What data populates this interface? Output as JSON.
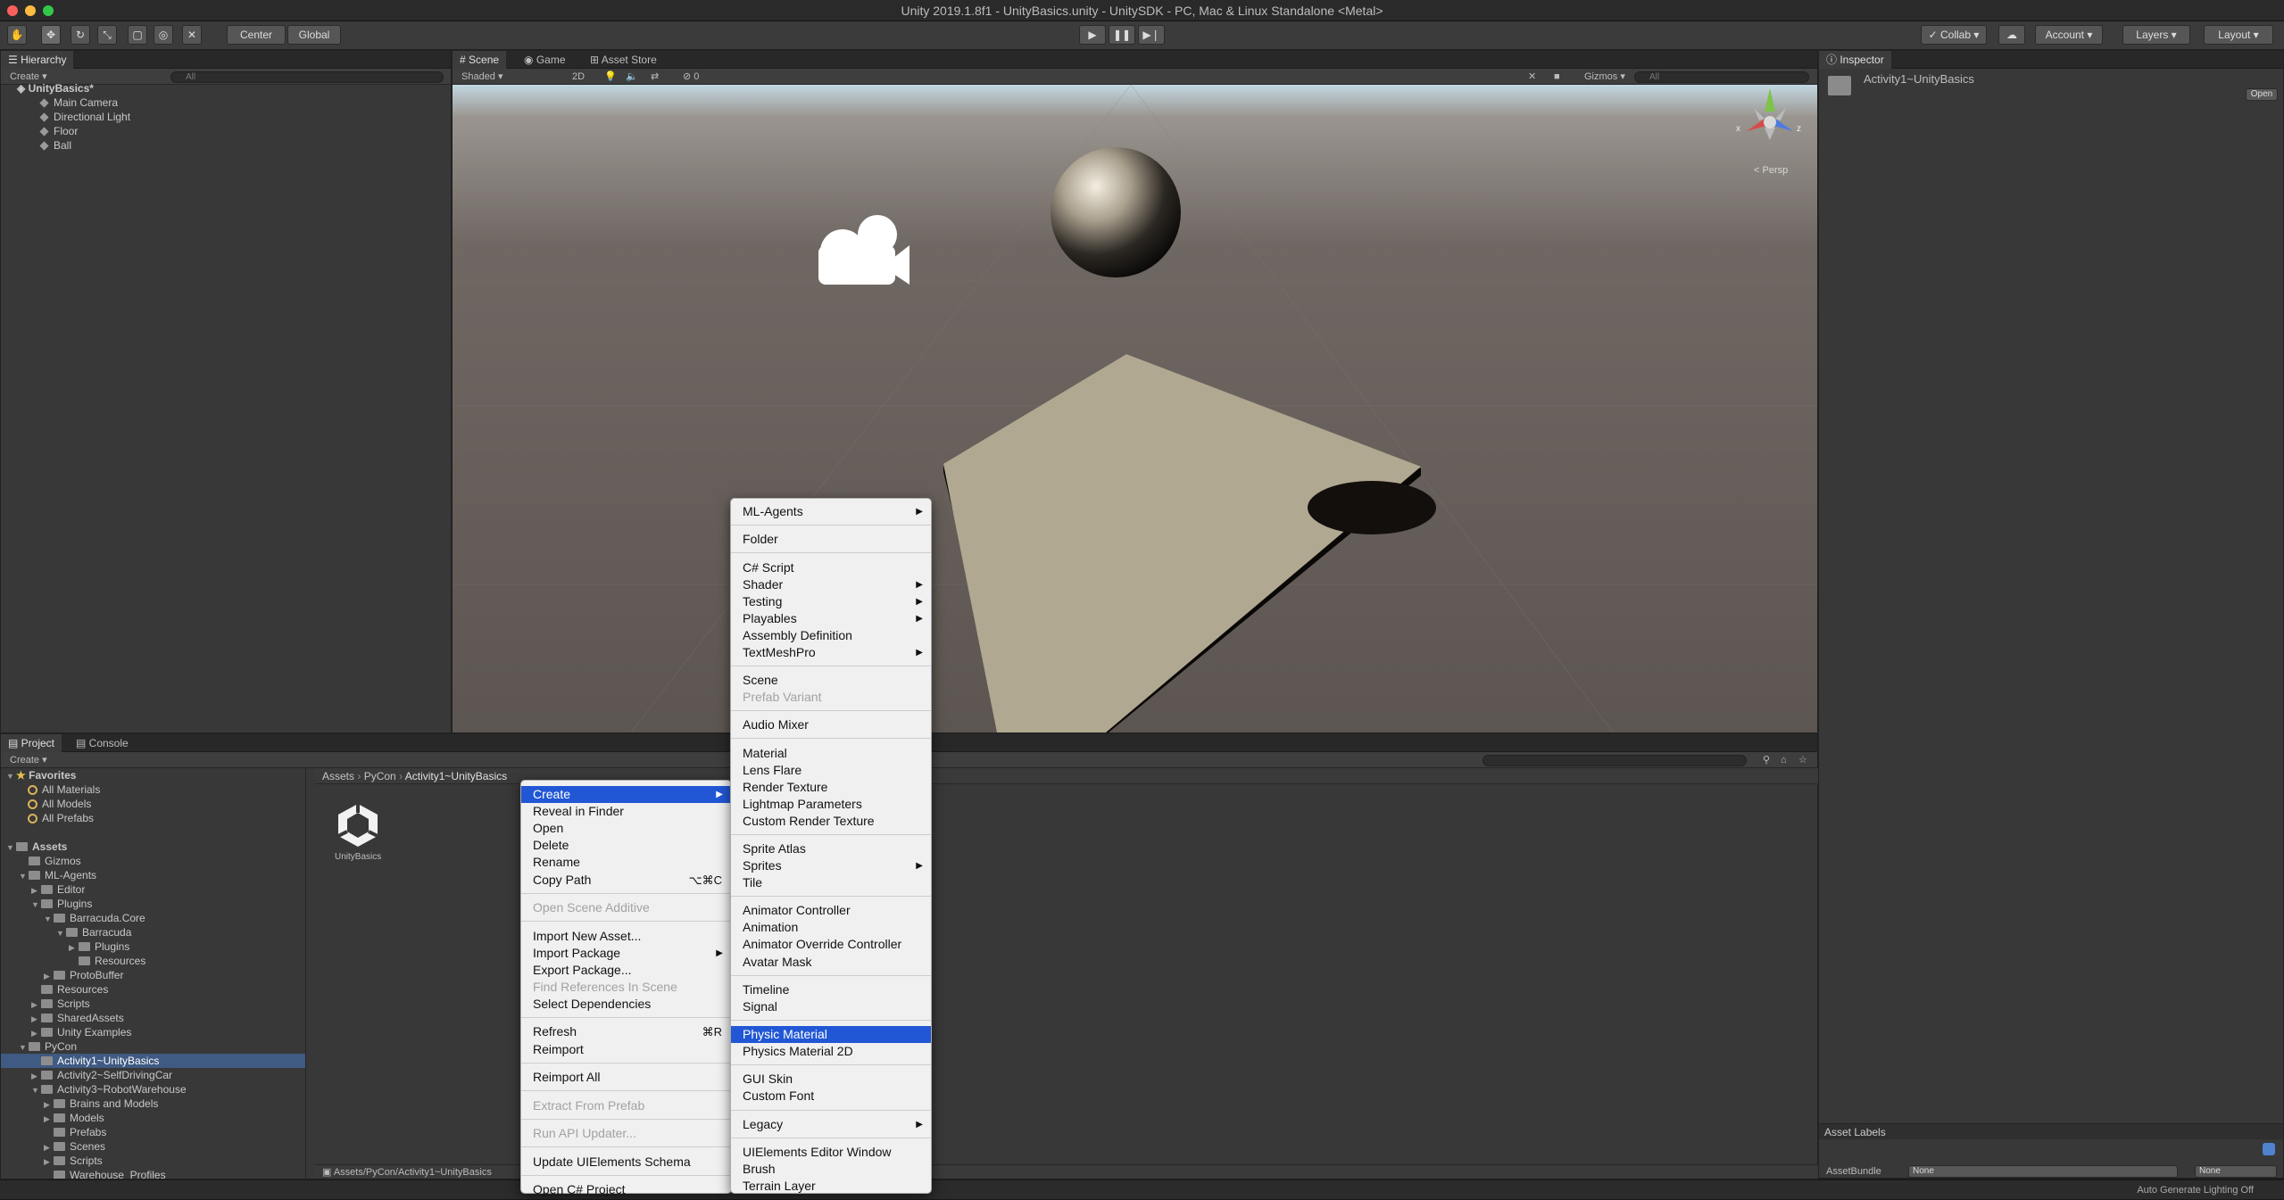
{
  "window": {
    "title": "Unity 2019.1.8f1 - UnityBasics.unity - UnitySDK - PC, Mac & Linux Standalone <Metal>"
  },
  "toolbar": {
    "pivot": "Center",
    "space": "Global",
    "collab": "Collab",
    "account": "Account",
    "layers": "Layers",
    "layout": "Layout"
  },
  "hierarchy": {
    "tab": "Hierarchy",
    "create": "Create",
    "search_placeholder": "All",
    "scene": "UnityBasics*",
    "items": [
      "Main Camera",
      "Directional Light",
      "Floor",
      "Ball"
    ]
  },
  "scene_view": {
    "tabs": [
      "Scene",
      "Game",
      "Asset Store"
    ],
    "shading": "Shaded",
    "mode_2d": "2D",
    "hidden_count": "0",
    "gizmos": "Gizmos",
    "search_placeholder": "All",
    "persp": "< Persp",
    "axis_x": "x",
    "axis_z": "z"
  },
  "inspector": {
    "tab": "Inspector",
    "asset_name": "Activity1~UnityBasics",
    "open_button": "Open",
    "asset_labels": "Asset Labels",
    "asset_bundle_label": "AssetBundle",
    "asset_bundle_value": "None",
    "asset_bundle_variant": "None"
  },
  "project": {
    "tabs": [
      "Project",
      "Console"
    ],
    "create": "Create",
    "favorites_label": "Favorites",
    "favorites": [
      "All Materials",
      "All Models",
      "All Prefabs"
    ],
    "assets_label": "Assets",
    "tree": [
      {
        "label": "Gizmos",
        "depth": 1,
        "arrow": ""
      },
      {
        "label": "ML-Agents",
        "depth": 1,
        "arrow": "▼"
      },
      {
        "label": "Editor",
        "depth": 2,
        "arrow": "▶"
      },
      {
        "label": "Plugins",
        "depth": 2,
        "arrow": "▼"
      },
      {
        "label": "Barracuda.Core",
        "depth": 3,
        "arrow": "▼"
      },
      {
        "label": "Barracuda",
        "depth": 4,
        "arrow": "▼"
      },
      {
        "label": "Plugins",
        "depth": 5,
        "arrow": "▶"
      },
      {
        "label": "Resources",
        "depth": 5,
        "arrow": ""
      },
      {
        "label": "ProtoBuffer",
        "depth": 3,
        "arrow": "▶"
      },
      {
        "label": "Resources",
        "depth": 2,
        "arrow": ""
      },
      {
        "label": "Scripts",
        "depth": 2,
        "arrow": "▶"
      },
      {
        "label": "SharedAssets",
        "depth": 2,
        "arrow": "▶"
      },
      {
        "label": "Unity Examples",
        "depth": 2,
        "arrow": "▶"
      },
      {
        "label": "PyCon",
        "depth": 1,
        "arrow": "▼"
      },
      {
        "label": "Activity1~UnityBasics",
        "depth": 2,
        "arrow": "",
        "selected": true
      },
      {
        "label": "Activity2~SelfDrivingCar",
        "depth": 2,
        "arrow": "▶"
      },
      {
        "label": "Activity3~RobotWarehouse",
        "depth": 2,
        "arrow": "▼"
      },
      {
        "label": "Brains and Models",
        "depth": 3,
        "arrow": "▶"
      },
      {
        "label": "Models",
        "depth": 3,
        "arrow": "▶"
      },
      {
        "label": "Prefabs",
        "depth": 3,
        "arrow": ""
      },
      {
        "label": "Scenes",
        "depth": 3,
        "arrow": "▶"
      },
      {
        "label": "Scripts",
        "depth": 3,
        "arrow": "▶"
      },
      {
        "label": "Warehouse_Profiles",
        "depth": 3,
        "arrow": ""
      }
    ],
    "breadcrumb": [
      "Assets",
      "PyCon",
      "Activity1~UnityBasics"
    ],
    "asset_tile": "UnityBasics",
    "footer_path": "Assets/PyCon/Activity1~UnityBasics"
  },
  "status_bar": {
    "text": "Auto Generate Lighting Off"
  },
  "context_menu": {
    "items": [
      {
        "label": "Create",
        "submenu": true,
        "highlight": true
      },
      {
        "label": "Reveal in Finder"
      },
      {
        "label": "Open"
      },
      {
        "label": "Delete"
      },
      {
        "label": "Rename"
      },
      {
        "label": "Copy Path",
        "shortcut": "⌥⌘C"
      },
      {
        "sep": true
      },
      {
        "label": "Open Scene Additive",
        "disabled": true
      },
      {
        "sep": true
      },
      {
        "label": "Import New Asset..."
      },
      {
        "label": "Import Package",
        "submenu": true
      },
      {
        "label": "Export Package..."
      },
      {
        "label": "Find References In Scene",
        "disabled": true
      },
      {
        "label": "Select Dependencies"
      },
      {
        "sep": true
      },
      {
        "label": "Refresh",
        "shortcut": "⌘R"
      },
      {
        "label": "Reimport"
      },
      {
        "sep": true
      },
      {
        "label": "Reimport All"
      },
      {
        "sep": true
      },
      {
        "label": "Extract From Prefab",
        "disabled": true
      },
      {
        "sep": true
      },
      {
        "label": "Run API Updater...",
        "disabled": true
      },
      {
        "sep": true
      },
      {
        "label": "Update UIElements Schema"
      },
      {
        "sep": true
      },
      {
        "label": "Open C# Project"
      }
    ]
  },
  "create_submenu": {
    "items": [
      {
        "label": "ML-Agents",
        "submenu": true
      },
      {
        "sep": true
      },
      {
        "label": "Folder"
      },
      {
        "sep": true
      },
      {
        "label": "C# Script"
      },
      {
        "label": "Shader",
        "submenu": true
      },
      {
        "label": "Testing",
        "submenu": true
      },
      {
        "label": "Playables",
        "submenu": true
      },
      {
        "label": "Assembly Definition"
      },
      {
        "label": "TextMeshPro",
        "submenu": true
      },
      {
        "sep": true
      },
      {
        "label": "Scene"
      },
      {
        "label": "Prefab Variant",
        "disabled": true
      },
      {
        "sep": true
      },
      {
        "label": "Audio Mixer"
      },
      {
        "sep": true
      },
      {
        "label": "Material"
      },
      {
        "label": "Lens Flare"
      },
      {
        "label": "Render Texture"
      },
      {
        "label": "Lightmap Parameters"
      },
      {
        "label": "Custom Render Texture"
      },
      {
        "sep": true
      },
      {
        "label": "Sprite Atlas"
      },
      {
        "label": "Sprites",
        "submenu": true
      },
      {
        "label": "Tile"
      },
      {
        "sep": true
      },
      {
        "label": "Animator Controller"
      },
      {
        "label": "Animation"
      },
      {
        "label": "Animator Override Controller"
      },
      {
        "label": "Avatar Mask"
      },
      {
        "sep": true
      },
      {
        "label": "Timeline"
      },
      {
        "label": "Signal"
      },
      {
        "sep": true
      },
      {
        "label": "Physic Material",
        "highlight": true
      },
      {
        "label": "Physics Material 2D"
      },
      {
        "sep": true
      },
      {
        "label": "GUI Skin"
      },
      {
        "label": "Custom Font"
      },
      {
        "sep": true
      },
      {
        "label": "Legacy",
        "submenu": true
      },
      {
        "sep": true
      },
      {
        "label": "UIElements Editor Window"
      },
      {
        "label": "Brush"
      },
      {
        "label": "Terrain Layer"
      }
    ]
  },
  "colors": {
    "highlight": "#2157d5",
    "selection": "#3f5a83",
    "panel": "#383838"
  }
}
